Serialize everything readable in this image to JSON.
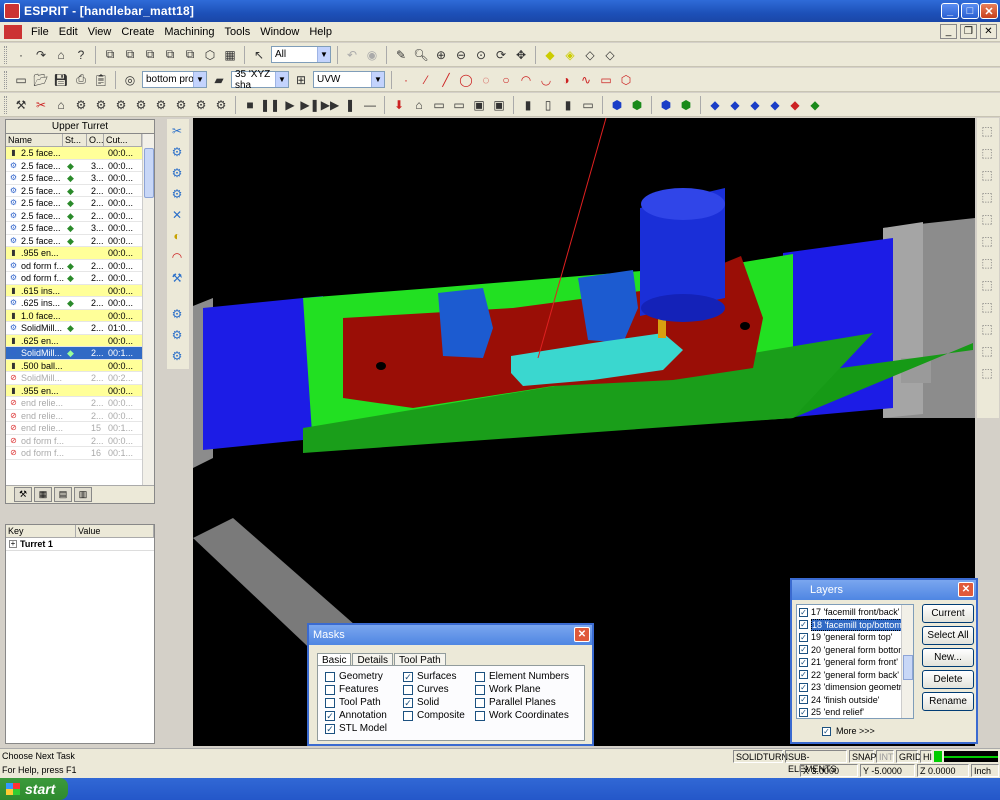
{
  "window": {
    "title": "ESPRIT - [handlebar_matt18]"
  },
  "menu": [
    "File",
    "Edit",
    "View",
    "Create",
    "Machining",
    "Tools",
    "Window",
    "Help"
  ],
  "toolbar1": {
    "select_combo": "All"
  },
  "toolbar2": {
    "view_combo": "bottom prof",
    "workplane_combo": "35 'XYZ sha",
    "uvw_combo": "UVW"
  },
  "turret_panel": {
    "title": "Upper Turret",
    "columns": [
      "Name",
      "St...",
      "O...",
      "Cut..."
    ],
    "rows": [
      {
        "name": "2.5 face...",
        "st": "",
        "o": "",
        "cut": "00:0...",
        "style": "yellow"
      },
      {
        "name": "2.5 face...",
        "st": "◆",
        "o": "3...",
        "cut": "00:0...",
        "style": ""
      },
      {
        "name": "2.5 face...",
        "st": "◆",
        "o": "3...",
        "cut": "00:0...",
        "style": ""
      },
      {
        "name": "2.5 face...",
        "st": "◆",
        "o": "2...",
        "cut": "00:0...",
        "style": ""
      },
      {
        "name": "2.5 face...",
        "st": "◆",
        "o": "2...",
        "cut": "00:0...",
        "style": ""
      },
      {
        "name": "2.5 face...",
        "st": "◆",
        "o": "2...",
        "cut": "00:0...",
        "style": ""
      },
      {
        "name": "2.5 face...",
        "st": "◆",
        "o": "3...",
        "cut": "00:0...",
        "style": ""
      },
      {
        "name": "2.5 face...",
        "st": "◆",
        "o": "2...",
        "cut": "00:0...",
        "style": ""
      },
      {
        "name": ".955 en...",
        "st": "",
        "o": "",
        "cut": "00:0...",
        "style": "yellow"
      },
      {
        "name": "od form f...",
        "st": "◆",
        "o": "2...",
        "cut": "00:0...",
        "style": ""
      },
      {
        "name": "od form f...",
        "st": "◆",
        "o": "2...",
        "cut": "00:0...",
        "style": ""
      },
      {
        "name": ".615 ins...",
        "st": "",
        "o": "",
        "cut": "00:0...",
        "style": "yellow"
      },
      {
        "name": ".625 ins...",
        "st": "◆",
        "o": "2...",
        "cut": "00:0...",
        "style": ""
      },
      {
        "name": "1.0 face...",
        "st": "",
        "o": "",
        "cut": "00:0...",
        "style": "yellow"
      },
      {
        "name": "SolidMill...",
        "st": "◆",
        "o": "2...",
        "cut": "01:0...",
        "style": ""
      },
      {
        "name": ".625 en...",
        "st": "",
        "o": "",
        "cut": "00:0...",
        "style": "yellow"
      },
      {
        "name": "SolidMill...",
        "st": "◆",
        "o": "2...",
        "cut": "00:1...",
        "style": "sel"
      },
      {
        "name": ".500 ball...",
        "st": "",
        "o": "",
        "cut": "00:0...",
        "style": "yellow"
      },
      {
        "name": "SolidMill...",
        "st": "",
        "o": "2...",
        "cut": "00:2...",
        "style": "dis"
      },
      {
        "name": ".955 en...",
        "st": "",
        "o": "",
        "cut": "00:0...",
        "style": "yellow"
      },
      {
        "name": "end relie...",
        "st": "",
        "o": "2...",
        "cut": "00:0...",
        "style": "dis"
      },
      {
        "name": "end relie...",
        "st": "",
        "o": "2...",
        "cut": "00:0...",
        "style": "dis"
      },
      {
        "name": "end relie...",
        "st": "",
        "o": "15",
        "cut": "00:1...",
        "style": "dis"
      },
      {
        "name": "od form f...",
        "st": "",
        "o": "2...",
        "cut": "00:0...",
        "style": "dis"
      },
      {
        "name": "od form f...",
        "st": "",
        "o": "16",
        "cut": "00:1...",
        "style": "dis"
      }
    ]
  },
  "props_panel": {
    "columns": [
      "Key",
      "Value"
    ],
    "rows": [
      {
        "key": "Turret 1",
        "value": ""
      }
    ]
  },
  "masks": {
    "title": "Masks",
    "tabs": [
      "Basic",
      "Details",
      "Tool Path"
    ],
    "col1": [
      {
        "label": "Geometry",
        "checked": false
      },
      {
        "label": "Features",
        "checked": false
      },
      {
        "label": "Tool Path",
        "checked": false
      },
      {
        "label": "Annotation",
        "checked": true
      },
      {
        "label": "STL Model",
        "checked": true
      }
    ],
    "col2": [
      {
        "label": "Surfaces",
        "checked": true
      },
      {
        "label": "Curves",
        "checked": false
      },
      {
        "label": "Solid",
        "checked": true
      },
      {
        "label": "Composite",
        "checked": false
      }
    ],
    "col3": [
      {
        "label": "Element Numbers",
        "checked": false
      },
      {
        "label": "Work Plane",
        "checked": false
      },
      {
        "label": "Parallel Planes",
        "checked": false
      },
      {
        "label": "Work Coordinates",
        "checked": false
      }
    ]
  },
  "layers": {
    "title": "Layers",
    "items": [
      {
        "label": "17 'facemill front/back'",
        "checked": true,
        "selected": false
      },
      {
        "label": "18 'facemill top/bottom'",
        "checked": true,
        "selected": true
      },
      {
        "label": "19 'general form top'",
        "checked": true,
        "selected": false
      },
      {
        "label": "20 'general form bottom'",
        "checked": true,
        "selected": false
      },
      {
        "label": "21 'general form front'",
        "checked": true,
        "selected": false
      },
      {
        "label": "22 'general form back'",
        "checked": true,
        "selected": false
      },
      {
        "label": "23 'dimension geometry'",
        "checked": true,
        "selected": false
      },
      {
        "label": "24 'finish outside'",
        "checked": true,
        "selected": false
      },
      {
        "label": "25 'end relief'",
        "checked": true,
        "selected": false
      }
    ],
    "buttons": [
      "Current",
      "Select All",
      "New...",
      "Delete",
      "Rename"
    ],
    "more": "More >>>"
  },
  "status": {
    "task": "Choose Next Task",
    "help": "For Help, press F1",
    "modes": [
      "SOLIDTURN",
      "SUB-ELEMENTS",
      "SNAP",
      "INT",
      "GRID",
      "HI"
    ],
    "x": "X 3.0000",
    "y": "Y -5.0000",
    "z": "Z 0.0000",
    "unit": "Inch"
  },
  "taskbar": {
    "start": "start"
  },
  "colors": {
    "viewport_bg": "#000000",
    "stock_blue": "#1818e8",
    "green": "#22e022",
    "part_red": "#9a0e06",
    "cyan": "#3ad7cf",
    "gray": "#8a8a8a"
  }
}
